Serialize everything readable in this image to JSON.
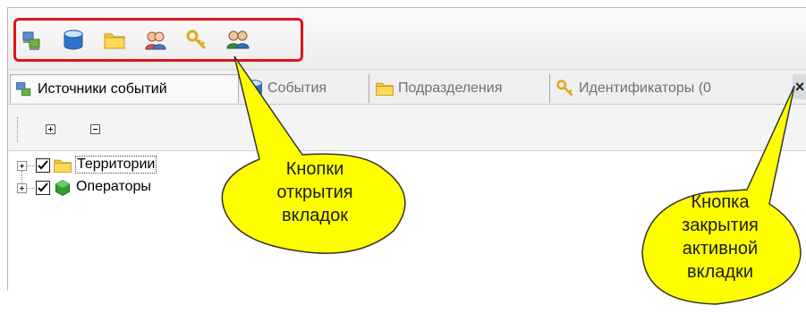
{
  "toolbar": {
    "buttons": [
      {
        "name": "event-sources-tab-button",
        "icon": "event-sources-icon"
      },
      {
        "name": "events-tab-button",
        "icon": "database-icon"
      },
      {
        "name": "departments-tab-button",
        "icon": "folder-icon"
      },
      {
        "name": "users-tab-button",
        "icon": "people-icon"
      },
      {
        "name": "identifiers-tab-button",
        "icon": "keys-icon"
      },
      {
        "name": "operators-tab-button",
        "icon": "operators-icon"
      }
    ],
    "highlight_color": "#e0141b"
  },
  "tabs": [
    {
      "label": "Источники событий",
      "icon": "event-sources-icon",
      "active": true
    },
    {
      "label": "События",
      "icon": "database-icon",
      "active": false
    },
    {
      "label": "Подразделения",
      "icon": "folder-icon",
      "active": false
    },
    {
      "label": "Идентификаторы (0",
      "icon": "keys-icon",
      "active": false
    }
  ],
  "tab_close_label": "×",
  "subtoolbar": {
    "expand_all_icon": "plus-box-icon",
    "collapse_all_icon": "minus-box-icon"
  },
  "tree": {
    "nodes": [
      {
        "label": "Территории",
        "checked": true,
        "icon": "folder-icon"
      },
      {
        "label": "Операторы",
        "checked": true,
        "icon": "green-cube-icon"
      }
    ]
  },
  "callouts": {
    "tab_buttons": "Кнопки\nоткрытия\nвкладок",
    "close_tab": "Кнопка\nзакрытия\nактивной\nвкладки",
    "fill_color": "#ffff00"
  }
}
